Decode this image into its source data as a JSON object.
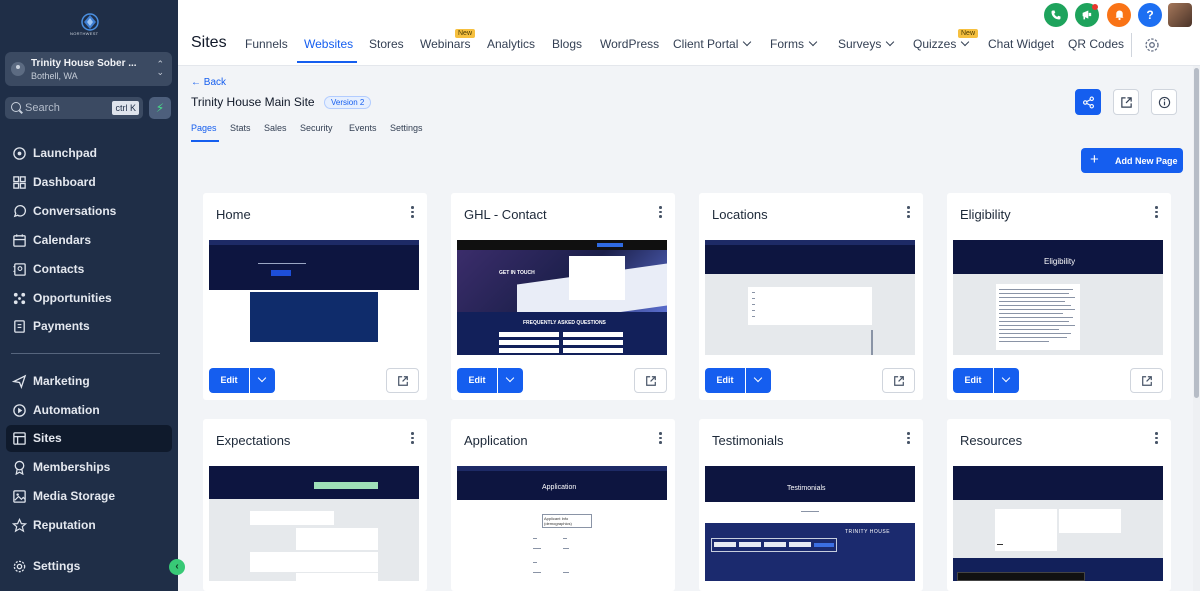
{
  "sidebar": {
    "logo_text": "NORTHWEST",
    "location": {
      "name": "Trinity House Sober ...",
      "city": "Bothell, WA"
    },
    "search": {
      "label": "Search",
      "shortcut": "ctrl K"
    },
    "items": [
      {
        "label": "Launchpad",
        "icon": "rocket-icon"
      },
      {
        "label": "Dashboard",
        "icon": "dashboard-icon"
      },
      {
        "label": "Conversations",
        "icon": "chat-icon"
      },
      {
        "label": "Calendars",
        "icon": "calendar-icon"
      },
      {
        "label": "Contacts",
        "icon": "contacts-icon"
      },
      {
        "label": "Opportunities",
        "icon": "opportunities-icon"
      },
      {
        "label": "Payments",
        "icon": "payments-icon"
      },
      {
        "label": "Marketing",
        "icon": "send-icon"
      },
      {
        "label": "Automation",
        "icon": "automation-icon"
      },
      {
        "label": "Sites",
        "icon": "sites-icon"
      },
      {
        "label": "Memberships",
        "icon": "badge-icon"
      },
      {
        "label": "Media Storage",
        "icon": "image-icon"
      },
      {
        "label": "Reputation",
        "icon": "star-icon"
      },
      {
        "label": "Settings",
        "icon": "gear-icon"
      }
    ],
    "active_item": "Sites"
  },
  "topbar": {
    "title": "Sites",
    "tabs": [
      {
        "label": "Funnels"
      },
      {
        "label": "Websites"
      },
      {
        "label": "Stores"
      },
      {
        "label": "Webinars",
        "badge": "New"
      },
      {
        "label": "Analytics"
      },
      {
        "label": "Blogs"
      },
      {
        "label": "WordPress"
      },
      {
        "label": "Client Portal"
      },
      {
        "label": "Forms"
      },
      {
        "label": "Surveys"
      },
      {
        "label": "Quizzes",
        "badge": "New"
      },
      {
        "label": "Chat Widget"
      },
      {
        "label": "QR Codes"
      }
    ],
    "active_tab": "Websites",
    "help_label": "?"
  },
  "site": {
    "back_label": "← Back",
    "title": "Trinity House Main Site",
    "version": "Version 2",
    "tabs": [
      "Pages",
      "Stats",
      "Sales",
      "Security",
      "Events",
      "Settings"
    ],
    "active_tab": "Pages",
    "add_page_label": "Add New Page"
  },
  "pages": [
    {
      "title": "Home",
      "edit_label": "Edit"
    },
    {
      "title": "GHL - Contact",
      "edit_label": "Edit"
    },
    {
      "title": "Locations",
      "edit_label": "Edit"
    },
    {
      "title": "Eligibility",
      "edit_label": "Edit"
    },
    {
      "title": "Expectations"
    },
    {
      "title": "Application"
    },
    {
      "title": "Testimonials"
    },
    {
      "title": "Resources"
    }
  ],
  "thumb_text": {
    "contact_heading": "GET IN TOUCH",
    "contact_faq": "FREQUENTLY ASKED QUESTIONS",
    "eligibility_heading": "Eligibility",
    "application_heading": "Application",
    "application_form_title": "Applicant Info (demographics)",
    "testimonials_heading": "Testimonials",
    "testimonials_brand": "TRINITY HOUSE"
  },
  "colors": {
    "sidebar_bg": "#1f2e47",
    "primary": "#155eef",
    "thumb_navy": "#0d1540",
    "badge_new": "#f6c03f"
  }
}
